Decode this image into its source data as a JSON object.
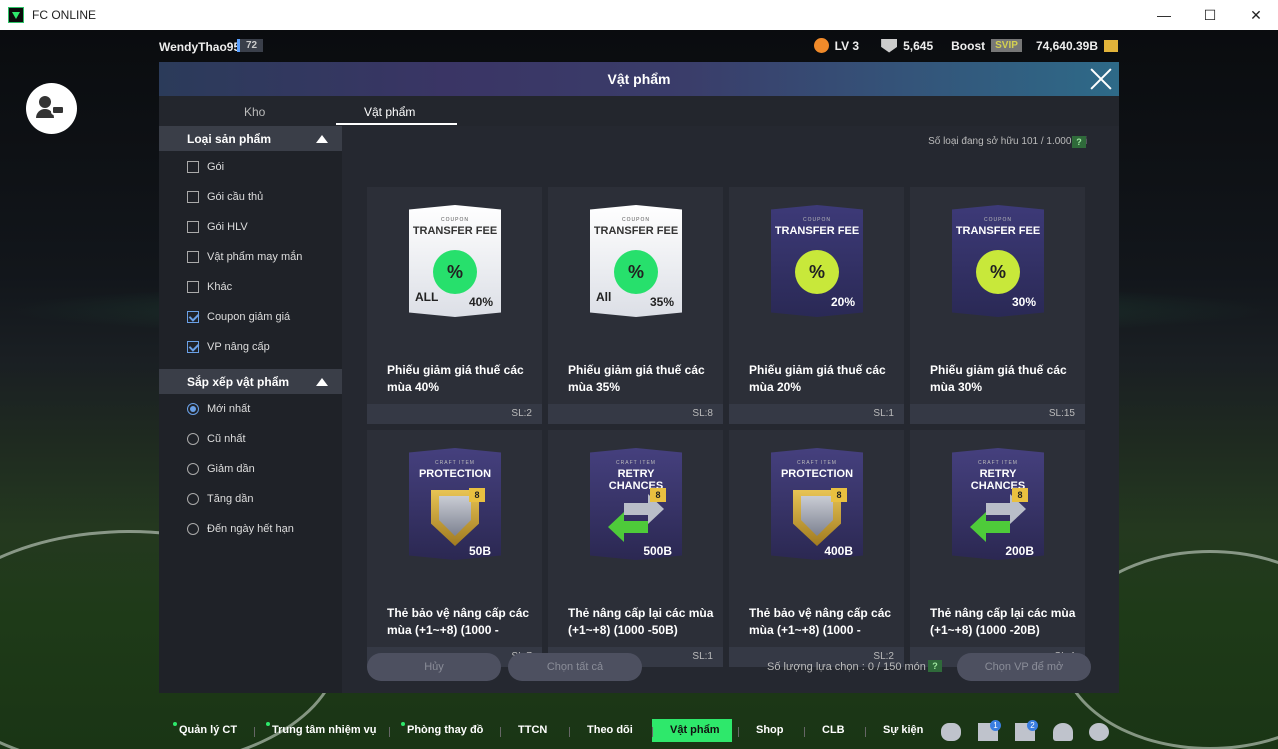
{
  "window": {
    "title": "FC ONLINE",
    "min": "—",
    "max": "☐",
    "close": "✕"
  },
  "player": {
    "name": "WendyThao95",
    "level_badge": "72",
    "lv": "LV 3",
    "points": "5,645",
    "boost": "Boost",
    "svip": "SVIP",
    "coins": "74,640.39B"
  },
  "panel": {
    "title": "Vật phẩm",
    "tabs": [
      "Kho",
      "Vật phẩm"
    ],
    "active_tab": "Vật phẩm",
    "owned_label": "Số loại đang sở hữu   101 / 1.000 cái",
    "help": "?"
  },
  "filters": {
    "category_title": "Loại sản phẩm",
    "categories": [
      {
        "label": "Gói",
        "checked": false
      },
      {
        "label": "Gói cầu thủ",
        "checked": false
      },
      {
        "label": "Gói HLV",
        "checked": false
      },
      {
        "label": "Vật phẩm may mắn",
        "checked": false
      },
      {
        "label": "Khác",
        "checked": false
      },
      {
        "label": "Coupon giảm giá",
        "checked": true
      },
      {
        "label": "VP nâng cấp",
        "checked": true
      }
    ],
    "sort_title": "Sắp xếp vật phẩm",
    "sorts": [
      {
        "label": "Mới nhất",
        "selected": true
      },
      {
        "label": "Cũ nhất",
        "selected": false
      },
      {
        "label": "Giảm dần",
        "selected": false
      },
      {
        "label": "Tăng dần",
        "selected": false
      },
      {
        "label": "Đến ngày hết hạn",
        "selected": false
      }
    ]
  },
  "items": [
    {
      "name": "Phiếu giảm giá thuế các mùa 40%",
      "qty": "SL:2",
      "kind": "coupon-w",
      "small": "COUPON",
      "title": "TRANSFER FEE",
      "pct": "40%",
      "all": "ALL"
    },
    {
      "name": "Phiếu giảm giá thuế các mùa 35%",
      "qty": "SL:8",
      "kind": "coupon-w",
      "small": "COUPON",
      "title": "TRANSFER FEE",
      "pct": "35%",
      "all": "All"
    },
    {
      "name": "Phiếu giảm giá thuế các mùa 20%",
      "qty": "SL:1",
      "kind": "coupon-d",
      "small": "COUPON",
      "title": "TRANSFER FEE",
      "pct": "20%",
      "all": ""
    },
    {
      "name": "Phiếu giảm giá thuế các mùa 30%",
      "qty": "SL:15",
      "kind": "coupon-d",
      "small": "COUPON",
      "title": "TRANSFER FEE",
      "pct": "30%",
      "all": ""
    },
    {
      "name": "Thẻ bảo vệ nâng cấp các mùa (+1~+8) (1000 -",
      "qty": "SL:7",
      "kind": "protect",
      "small": "CRAFT ITEM",
      "title": "PROTECTION",
      "max": "50B"
    },
    {
      "name": "Thẻ nâng cấp lại các mùa (+1~+8) (1000 -50B)",
      "qty": "SL:1",
      "kind": "retry",
      "small": "CRAFT ITEM",
      "title": "RETRY CHANCES",
      "max": "500B"
    },
    {
      "name": "Thẻ bảo vệ nâng cấp các mùa (+1~+8) (1000 -",
      "qty": "SL:2",
      "kind": "protect",
      "small": "CRAFT ITEM",
      "title": "PROTECTION",
      "max": "400B"
    },
    {
      "name": "Thẻ nâng cấp lại các mùa (+1~+8) (1000 -20B)",
      "qty": "SL:4",
      "kind": "retry",
      "small": "CRAFT ITEM",
      "title": "RETRY CHANCES",
      "max": "200B"
    }
  ],
  "actions": {
    "cancel": "Hủy",
    "select_all": "Chọn tất cả",
    "selected_count": "Số lượng lựa chọn : 0 / 150 món",
    "select_items": "Chọn VP để mở"
  },
  "bottom_nav": [
    {
      "label": "Quản lý CT",
      "dot": true
    },
    {
      "label": "Trung tâm nhiệm vụ",
      "dot": true
    },
    {
      "label": "Phòng thay đồ",
      "dot": true
    },
    {
      "label": "TTCN",
      "dot": false
    },
    {
      "label": "Theo dõi",
      "dot": false
    },
    {
      "label": "Vật phẩm",
      "dot": false,
      "active": true
    },
    {
      "label": "Shop",
      "dot": false
    },
    {
      "label": "CLB",
      "dot": false
    },
    {
      "label": "Sự kiện",
      "dot": false
    }
  ],
  "bottom_icons": [
    {
      "name": "chat-icon"
    },
    {
      "name": "home-icon",
      "badge": "1"
    },
    {
      "name": "bell-icon",
      "badge": "2"
    },
    {
      "name": "profile-icon"
    },
    {
      "name": "settings-icon"
    }
  ],
  "colors": {
    "accent": "#2ee86b",
    "panel": "#252830",
    "check": "#6aa0e6"
  }
}
